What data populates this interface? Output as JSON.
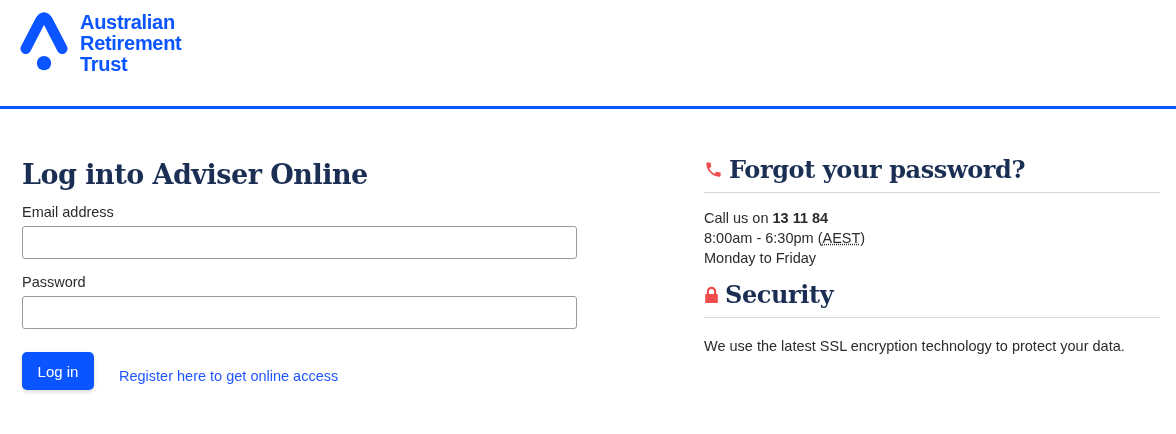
{
  "logo": {
    "lines": [
      "Australian",
      "Retirement",
      "Trust"
    ]
  },
  "login": {
    "title": "Log into Adviser Online",
    "fields": [
      {
        "label": "Email address"
      },
      {
        "label": "Password"
      }
    ],
    "button": "Log in",
    "register_link": "Register here to get online access"
  },
  "forgot": {
    "title": "Forgot your password?",
    "call": "Call us on **13 11 84**",
    "hours": {
      "before": "8:00am - 6:30pm (",
      "abbr": "AEST",
      "after": ")"
    },
    "days": "Monday to Friday"
  },
  "security": {
    "title": "Security",
    "text": "We use the latest SSL encryption technology to protect your data."
  }
}
